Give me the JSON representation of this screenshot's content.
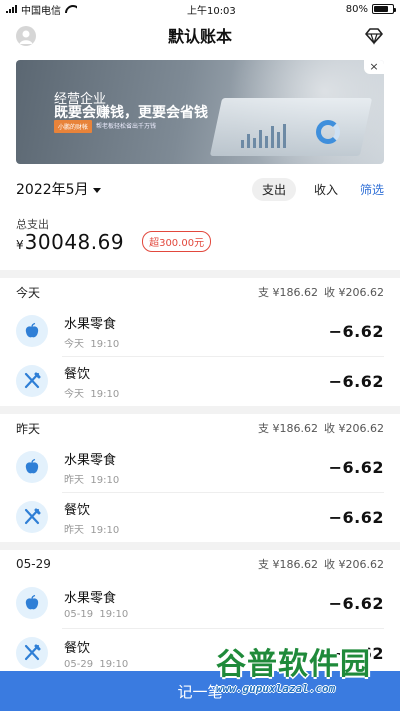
{
  "status_bar": {
    "carrier": "中国电信",
    "time": "上午10:03",
    "battery": "80%",
    "battery_level": 0.8
  },
  "header": {
    "title": "默认账本"
  },
  "banner": {
    "headline": "经营企业",
    "title": "既要会赚钱，更要会省钱",
    "tag": "小鹏的财帐",
    "subtitle": "帮老板轻松省出千万钱",
    "close": "×"
  },
  "filter": {
    "month": "2022年5月",
    "expense": "支出",
    "income": "收入",
    "filter": "筛选"
  },
  "summary": {
    "label": "总支出",
    "currency": "¥",
    "amount": "30048.69",
    "over_budget": "超300.00元"
  },
  "groups": [
    {
      "name": "今天",
      "expense": "支 ¥186.62",
      "income": "收 ¥206.62",
      "items": [
        {
          "icon": "apple-icon",
          "name": "水果零食",
          "day": "今天",
          "time": "19:10",
          "amount": "−6.62"
        },
        {
          "icon": "fork-knife-icon",
          "name": "餐饮",
          "day": "今天",
          "time": "19:10",
          "amount": "−6.62"
        }
      ]
    },
    {
      "name": "昨天",
      "expense": "支 ¥186.62",
      "income": "收 ¥206.62",
      "items": [
        {
          "icon": "apple-icon",
          "name": "水果零食",
          "day": "昨天",
          "time": "19:10",
          "amount": "−6.62"
        },
        {
          "icon": "fork-knife-icon",
          "name": "餐饮",
          "day": "昨天",
          "time": "19:10",
          "amount": "−6.62"
        }
      ]
    },
    {
      "name": "05-29",
      "expense": "支 ¥186.62",
      "income": "收 ¥206.62",
      "items": [
        {
          "icon": "apple-icon",
          "name": "水果零食",
          "day": "05-19",
          "time": "19:10",
          "amount": "−6.62"
        },
        {
          "icon": "fork-knife-icon",
          "name": "餐饮",
          "day": "05-29",
          "time": "19:10",
          "amount": "−6.62"
        }
      ]
    }
  ],
  "bottom_button": {
    "label": "记一笔"
  },
  "watermark": {
    "name": "谷普软件园",
    "url": "www.gupuxlazal.com"
  },
  "colors": {
    "accent": "#3a7be0",
    "danger": "#e2483d",
    "icon_bg": "#e3f1fc",
    "icon_fg": "#2f7fd6"
  }
}
